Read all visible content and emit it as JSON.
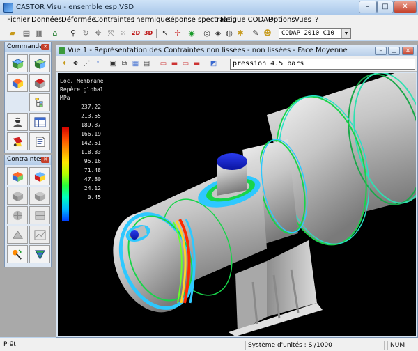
{
  "window": {
    "title": "CASTOR Visu - ensemble esp.VSD",
    "minimize": "–",
    "maximize": "□",
    "close": "✕"
  },
  "menu": [
    "Fichier",
    "Données",
    "Déformée",
    "Contraintes",
    "Thermique",
    "Réponse spectrale",
    "Fatigue CODAP",
    "Options",
    "Vues",
    "?"
  ],
  "toolbar": {
    "code_value": "CODAP 2010 C10",
    "icons": [
      "open-folder-icon",
      "print-icon",
      "print-preview-icon",
      "home-icon",
      "zoom-icon",
      "rotate-icon",
      "pan-icon",
      "fit-icon",
      "view-2d-icon",
      "view-3d-icon",
      "pointer-icon",
      "mesh-icon",
      "node-icon",
      "element-icon",
      "group-icon",
      "select-icon",
      "label-icon",
      "settings-icon"
    ]
  },
  "palettes": {
    "commandes": {
      "title": "Commandes",
      "close": "✕"
    },
    "contraintes": {
      "title": "Contraintes",
      "close": "✕"
    }
  },
  "view": {
    "title": "Vue 1 - Représentation des Contraintes non lissées - non lissées - Face Moyenne",
    "load_case": "pression 4.5 bars",
    "minimize": "–",
    "maximize": "□",
    "close": "✕"
  },
  "legend": {
    "line1": "Loc. Membrane",
    "line2": "Repère global",
    "unit": "MPa",
    "values": [
      "237.22",
      "213.55",
      "189.87",
      "166.19",
      "142.51",
      "118.83",
      "95.16",
      "71.48",
      "47.80",
      "24.12",
      "0.45"
    ]
  },
  "status": {
    "left": "Prêt",
    "units": "Système d'unités : SI/1000",
    "num": "NUM"
  },
  "colors": {
    "titlebar": "#b8d1ee",
    "canvas": "#000000",
    "vessel": "#c8c8c8",
    "nozzle_cap": "#1020d0",
    "accent_hot": "#d40000"
  }
}
